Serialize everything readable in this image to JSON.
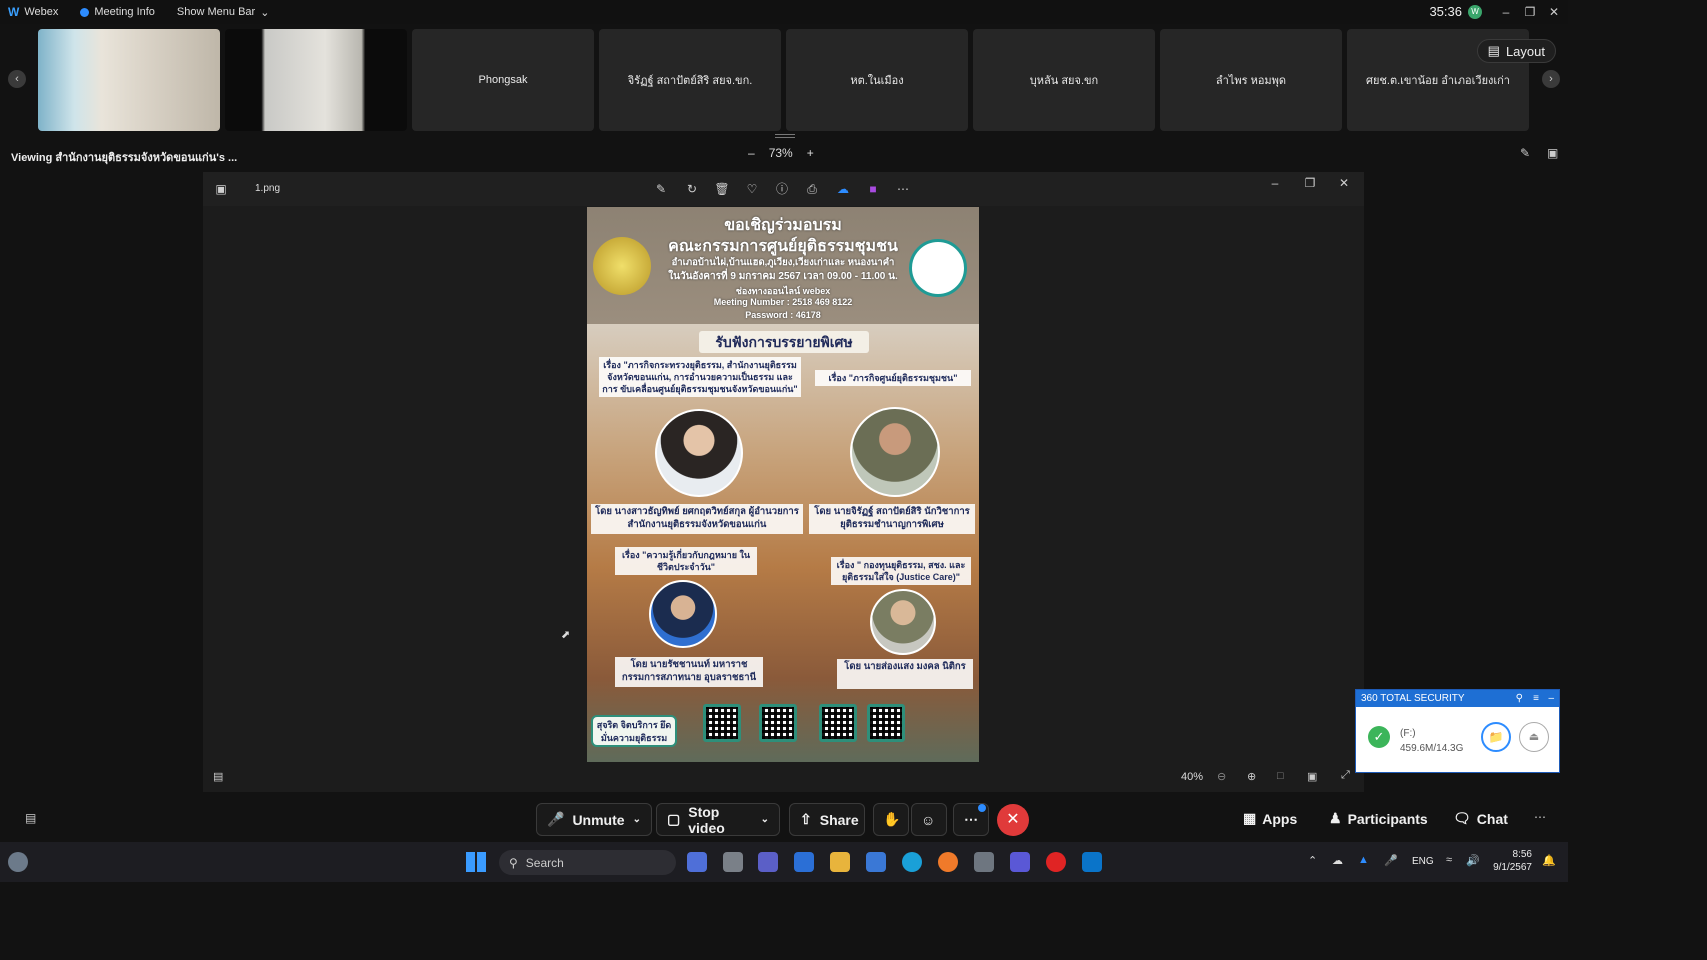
{
  "titlebar": {
    "app_name": "Webex",
    "meeting_info": "Meeting Info",
    "show_menu_bar": "Show Menu Bar",
    "clock": "35:36",
    "avatar_initial": "W"
  },
  "participants": [
    {
      "name": ""
    },
    {
      "name": ""
    },
    {
      "name": "Phongsak"
    },
    {
      "name": "จิรัฏฐ์ สถาปัตย์สิริ สยจ.ขก."
    },
    {
      "name": "หต.ในเมือง"
    },
    {
      "name": "บุหลัน สยจ.ขก"
    },
    {
      "name": "ลำไพร หอมพุด"
    },
    {
      "name": "ศยช.ต.เขาน้อย อำเภอเวียงเก่า"
    }
  ],
  "layout_button": "Layout",
  "viewing": {
    "text": "Viewing สำนักงานยุติธรรมจังหวัดขอนแก่น's ...",
    "zoom": "73%"
  },
  "shared_window": {
    "filename": "1.png",
    "zoom_percent": "40%"
  },
  "poster": {
    "line1": "ขอเชิญร่วมอบรม",
    "line2": "คณะกรรมการศูนย์ยุติธรรมชุมชน",
    "line3": "อำเภอบ้านไผ่,บ้านแฮด,ภูเวียง,เวียงเก่าและ หนองนาคำ",
    "line4": "ในวันอังคารที่ 9 มกราคม 2567 เวลา 09.00 - 11.00 น.",
    "line5": "ช่องทางออนไลน์ webex",
    "meeting_number": "Meeting Number : 2518 469 8122",
    "password": "Password : 46178",
    "band": "รับฟังการบรรยายพิเศษ",
    "topic1": "เรื่อง \"ภารกิจกระทรวงยุติธรรม, สำนักงานยุติธรรม จังหวัดขอนแก่น, การอำนวยความเป็นธรรม และการ ขับเคลื่อนศูนย์ยุติธรรมชุมชนจังหวัดขอนแก่น\"",
    "topic2": "เรื่อง \"ภารกิจศูนย์ยุติธรรมชุมชน\"",
    "speaker1": "โดย นางสาวธัญทิพย์ ยศกฤตวิทย์สกุล ผู้อำนวยการสำนักงานยุติธรรมจังหวัดขอนแก่น",
    "speaker2": "โดย นายจิรัฏฐ์ สถาปัตย์สิริ นักวิชาการยุติธรรมชำนาญการพิเศษ",
    "topic3": "เรื่อง \"ความรู้เกี่ยวกับกฎหมาย ในชีวิตประจำวัน\"",
    "topic4": "เรื่อง \" กองทุนยุติธรรม, สชง. และ ยุติธรรมใส่ใจ (Justice Care)\"",
    "speaker3": "โดย นายรัชชานนท์ มหาราช กรรมการสภาทนาย อุบลราชธานี",
    "speaker4": "โดย นายส่องแสง มงคล นิติกร",
    "stamp": "สุจริต จิตบริการ ยึดมั่นความยุติธรรม"
  },
  "security_widget": {
    "title": "360 TOTAL SECURITY",
    "drive": "(F:)",
    "usage": "459.6M/14.3G"
  },
  "controls": {
    "unmute": "Unmute",
    "stop_video": "Stop video",
    "share": "Share",
    "apps": "Apps",
    "participants": "Participants",
    "chat": "Chat"
  },
  "taskbar": {
    "search_placeholder": "Search",
    "language": "ENG",
    "time": "8:56",
    "date": "9/1/2567"
  }
}
